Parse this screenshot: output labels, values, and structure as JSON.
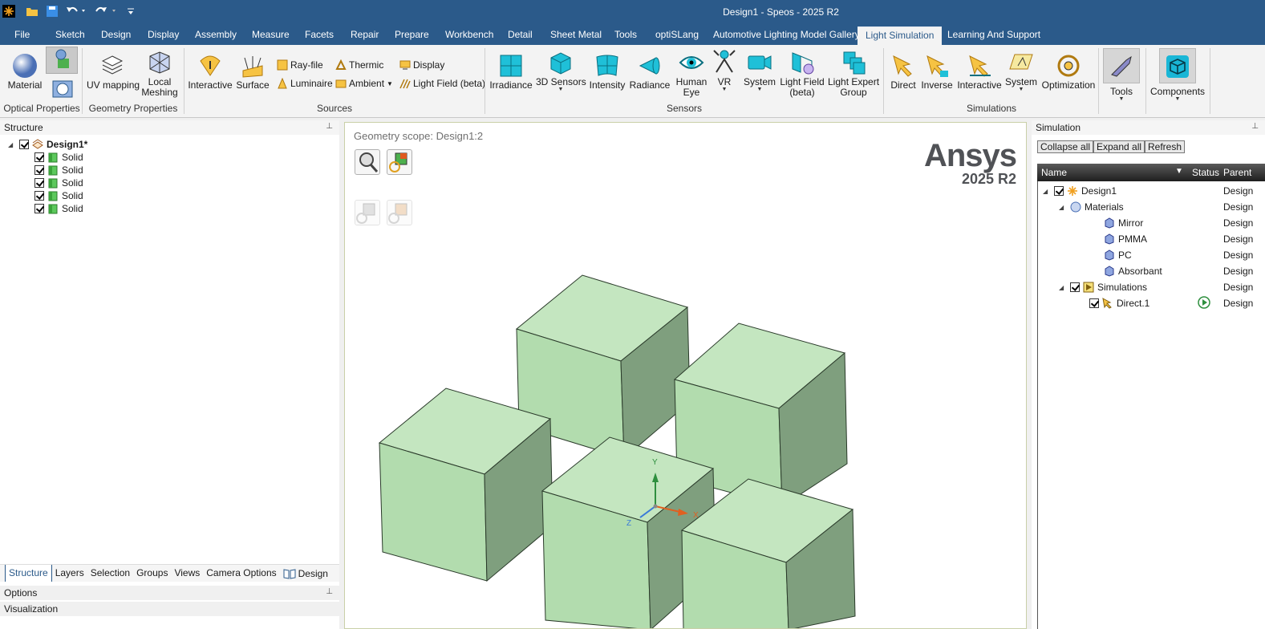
{
  "window": {
    "title": "Design1 - Speos - 2025 R2"
  },
  "menu": [
    "File",
    "Sketch",
    "Design",
    "Display",
    "Assembly",
    "Measure",
    "Facets",
    "Repair",
    "Prepare",
    "Workbench",
    "Detail",
    "Sheet Metal",
    "Tools",
    "optiSLang",
    "Automotive Lighting Model Gallery",
    "Light Simulation",
    "Learning And Support"
  ],
  "ribbon": {
    "optical": {
      "material": "Material",
      "group": "Optical Properties"
    },
    "geometry": {
      "uv": "UV mapping",
      "local1": "Local",
      "local2": "Meshing",
      "group": "Geometry Properties"
    },
    "sources": {
      "interactive": "Interactive",
      "surface": "Surface",
      "rayfile": "Ray-file",
      "luminaire": "Luminaire",
      "thermic": "Thermic",
      "ambient": "Ambient",
      "display": "Display",
      "lightfield": "Light Field (beta)",
      "group": "Sources"
    },
    "sensors": {
      "irradiance": "Irradiance",
      "sensors3d": "3D Sensors",
      "intensity": "Intensity",
      "radiance": "Radiance",
      "human1": "Human",
      "human2": "Eye",
      "vr": "VR",
      "system": "System",
      "lf1": "Light Field",
      "lf2": "(beta)",
      "le1": "Light Expert",
      "le2": "Group",
      "group": "Sensors"
    },
    "simulations": {
      "direct": "Direct",
      "inverse": "Inverse",
      "interactive": "Interactive",
      "system": "System",
      "optimization": "Optimization",
      "group": "Simulations"
    },
    "tools": "Tools",
    "components": "Components"
  },
  "structure": {
    "title": "Structure",
    "root": "Design1*",
    "items": [
      "Solid",
      "Solid",
      "Solid",
      "Solid",
      "Solid"
    ],
    "tabs": [
      "Structure",
      "Layers",
      "Selection",
      "Groups",
      "Views",
      "Camera Options",
      "Design"
    ],
    "options": "Options",
    "visualization": "Visualization"
  },
  "viewport": {
    "scope": "Geometry scope: Design1:2",
    "brand": "Ansys",
    "version": "2025 R2",
    "axis_y": "Y",
    "axis_x": "X",
    "axis_z": "Z"
  },
  "simulation": {
    "title": "Simulation",
    "collapse": "Collapse all",
    "expand": "Expand all",
    "refresh": "Refresh",
    "columns": {
      "name": "Name",
      "status": "Status",
      "parent": "Parent"
    },
    "parent_value": "Design",
    "tree": {
      "root": "Design1",
      "materials": "Materials",
      "mat_items": [
        "Mirror",
        "PMMA",
        "PC",
        "Absorbant"
      ],
      "simulations": "Simulations",
      "direct": "Direct.1"
    }
  }
}
